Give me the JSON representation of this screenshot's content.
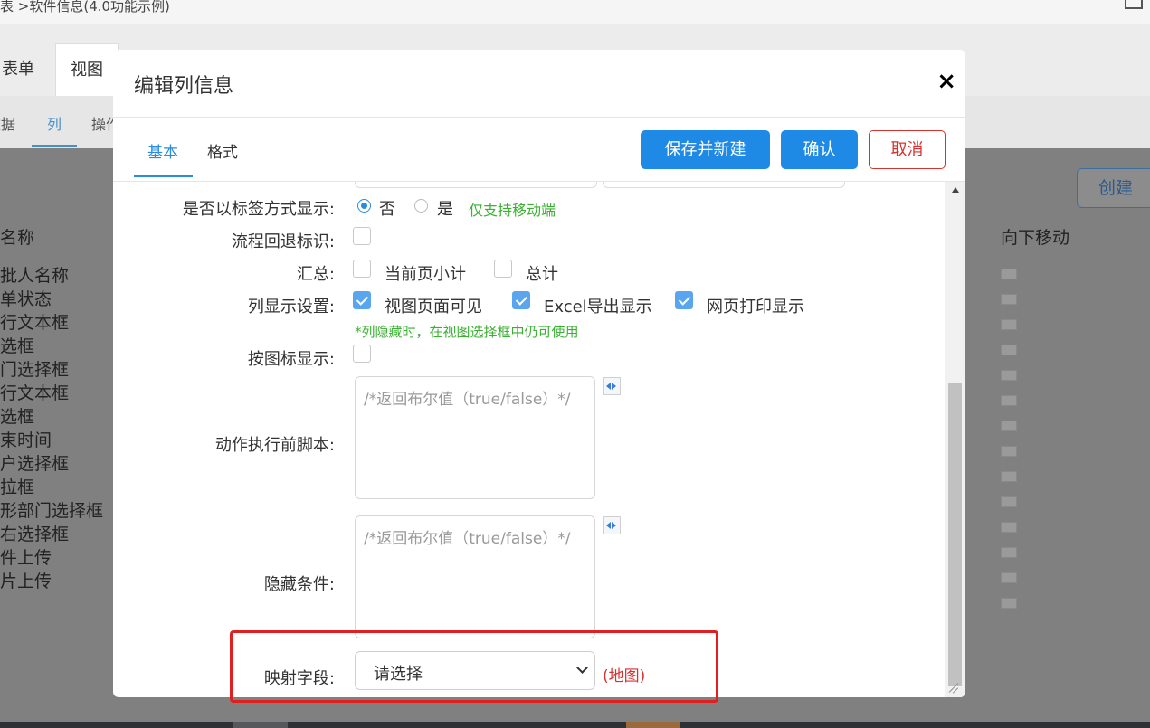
{
  "background": {
    "breadcrumb": "表 >软件信息(4.0功能示例)",
    "tabs": [
      "表单",
      "视图"
    ],
    "subtabs": [
      "数据",
      "列",
      "操作"
    ],
    "create_button": "创建",
    "column_headers": {
      "name": "名称",
      "move_down": "向下移动"
    },
    "rows": [
      "批人名称",
      "单状态",
      "行文本框",
      "选框",
      "门选择框",
      "行文本框",
      "选框",
      "束时间",
      "户选择框",
      "拉框",
      "形部门选择框",
      "右选择框",
      "件上传",
      "片上传"
    ]
  },
  "modal": {
    "title": "编辑列信息",
    "close_icon": "×",
    "tabs": [
      "基本",
      "格式"
    ],
    "buttons": {
      "save_new": "保存并新建",
      "confirm": "确认",
      "cancel": "取消"
    },
    "fields": {
      "tag_display": {
        "label": "是否以标签方式显示:",
        "options": [
          "否",
          "是"
        ],
        "selected": "否",
        "note": "仅支持移动端"
      },
      "flow_rollback": {
        "label": "流程回退标识:",
        "checked": false
      },
      "summary": {
        "label": "汇总:",
        "options": [
          {
            "label": "当前页小计",
            "checked": false
          },
          {
            "label": "总计",
            "checked": false
          }
        ]
      },
      "column_display": {
        "label": "列显示设置:",
        "options": [
          {
            "label": "视图页面可见",
            "checked": true
          },
          {
            "label": "Excel导出显示",
            "checked": true
          },
          {
            "label": "网页打印显示",
            "checked": true
          }
        ],
        "note": "*列隐藏时，在视图选择框中仍可使用"
      },
      "icon_display": {
        "label": "按图标显示:",
        "checked": false
      },
      "pre_action_script": {
        "label": "动作执行前脚本:",
        "placeholder": "/*返回布尔值（true/false）*/"
      },
      "hide_condition": {
        "label": "隐藏条件:",
        "placeholder": "/*返回布尔值（true/false）*/"
      },
      "mapping_field": {
        "label": "映射字段:",
        "value": "请选择",
        "note": "(地图)"
      }
    }
  },
  "colors": {
    "primary": "#1f8ae5",
    "danger": "#d9312e",
    "success": "#3bb033",
    "highlight": "#e02020"
  }
}
